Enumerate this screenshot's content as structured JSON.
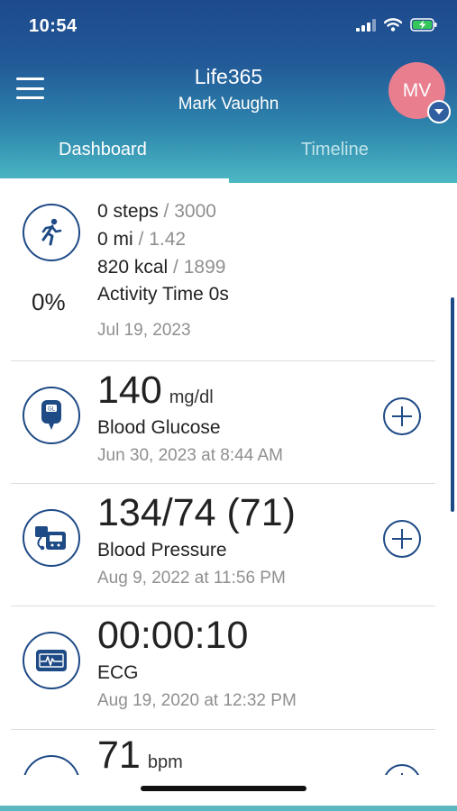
{
  "status": {
    "time": "10:54"
  },
  "header": {
    "title": "Life365",
    "user": "Mark Vaughn",
    "avatar_initials": "MV"
  },
  "tabs": [
    {
      "label": "Dashboard",
      "active": true
    },
    {
      "label": "Timeline",
      "active": false
    }
  ],
  "activity": {
    "icon": "running-icon",
    "percent": "0%",
    "steps_value": "0 steps",
    "steps_sep": " / ",
    "steps_goal": "3000",
    "distance_value": "0 mi",
    "distance_sep": " / ",
    "distance_goal": "1.42",
    "calories_value": "820 kcal",
    "calories_sep": " / ",
    "calories_goal": "1899",
    "activity_time": "Activity Time 0s",
    "date": "Jul 19, 2023"
  },
  "glucose": {
    "icon": "glucose-meter-icon",
    "icon_text": "GL",
    "value": "140",
    "unit": "mg/dl",
    "label": "Blood Glucose",
    "date": "Jun 30, 2023 at 8:44 AM"
  },
  "blood_pressure": {
    "icon": "blood-pressure-monitor-icon",
    "value": "134/74 (71)",
    "label": "Blood Pressure",
    "date": "Aug 9, 2022 at 11:56 PM"
  },
  "ecg": {
    "icon": "ecg-monitor-icon",
    "value": "00:00:10",
    "label": "ECG",
    "date": "Aug 19, 2020 at 12:32 PM"
  },
  "heart_rate": {
    "value": "71",
    "unit": "bpm"
  },
  "colors": {
    "header_top": "#1d4a8c",
    "header_bottom": "#4cb8c4",
    "accent": "#1e4a86",
    "avatar": "#e97e8f",
    "muted": "#8f8f8f"
  }
}
